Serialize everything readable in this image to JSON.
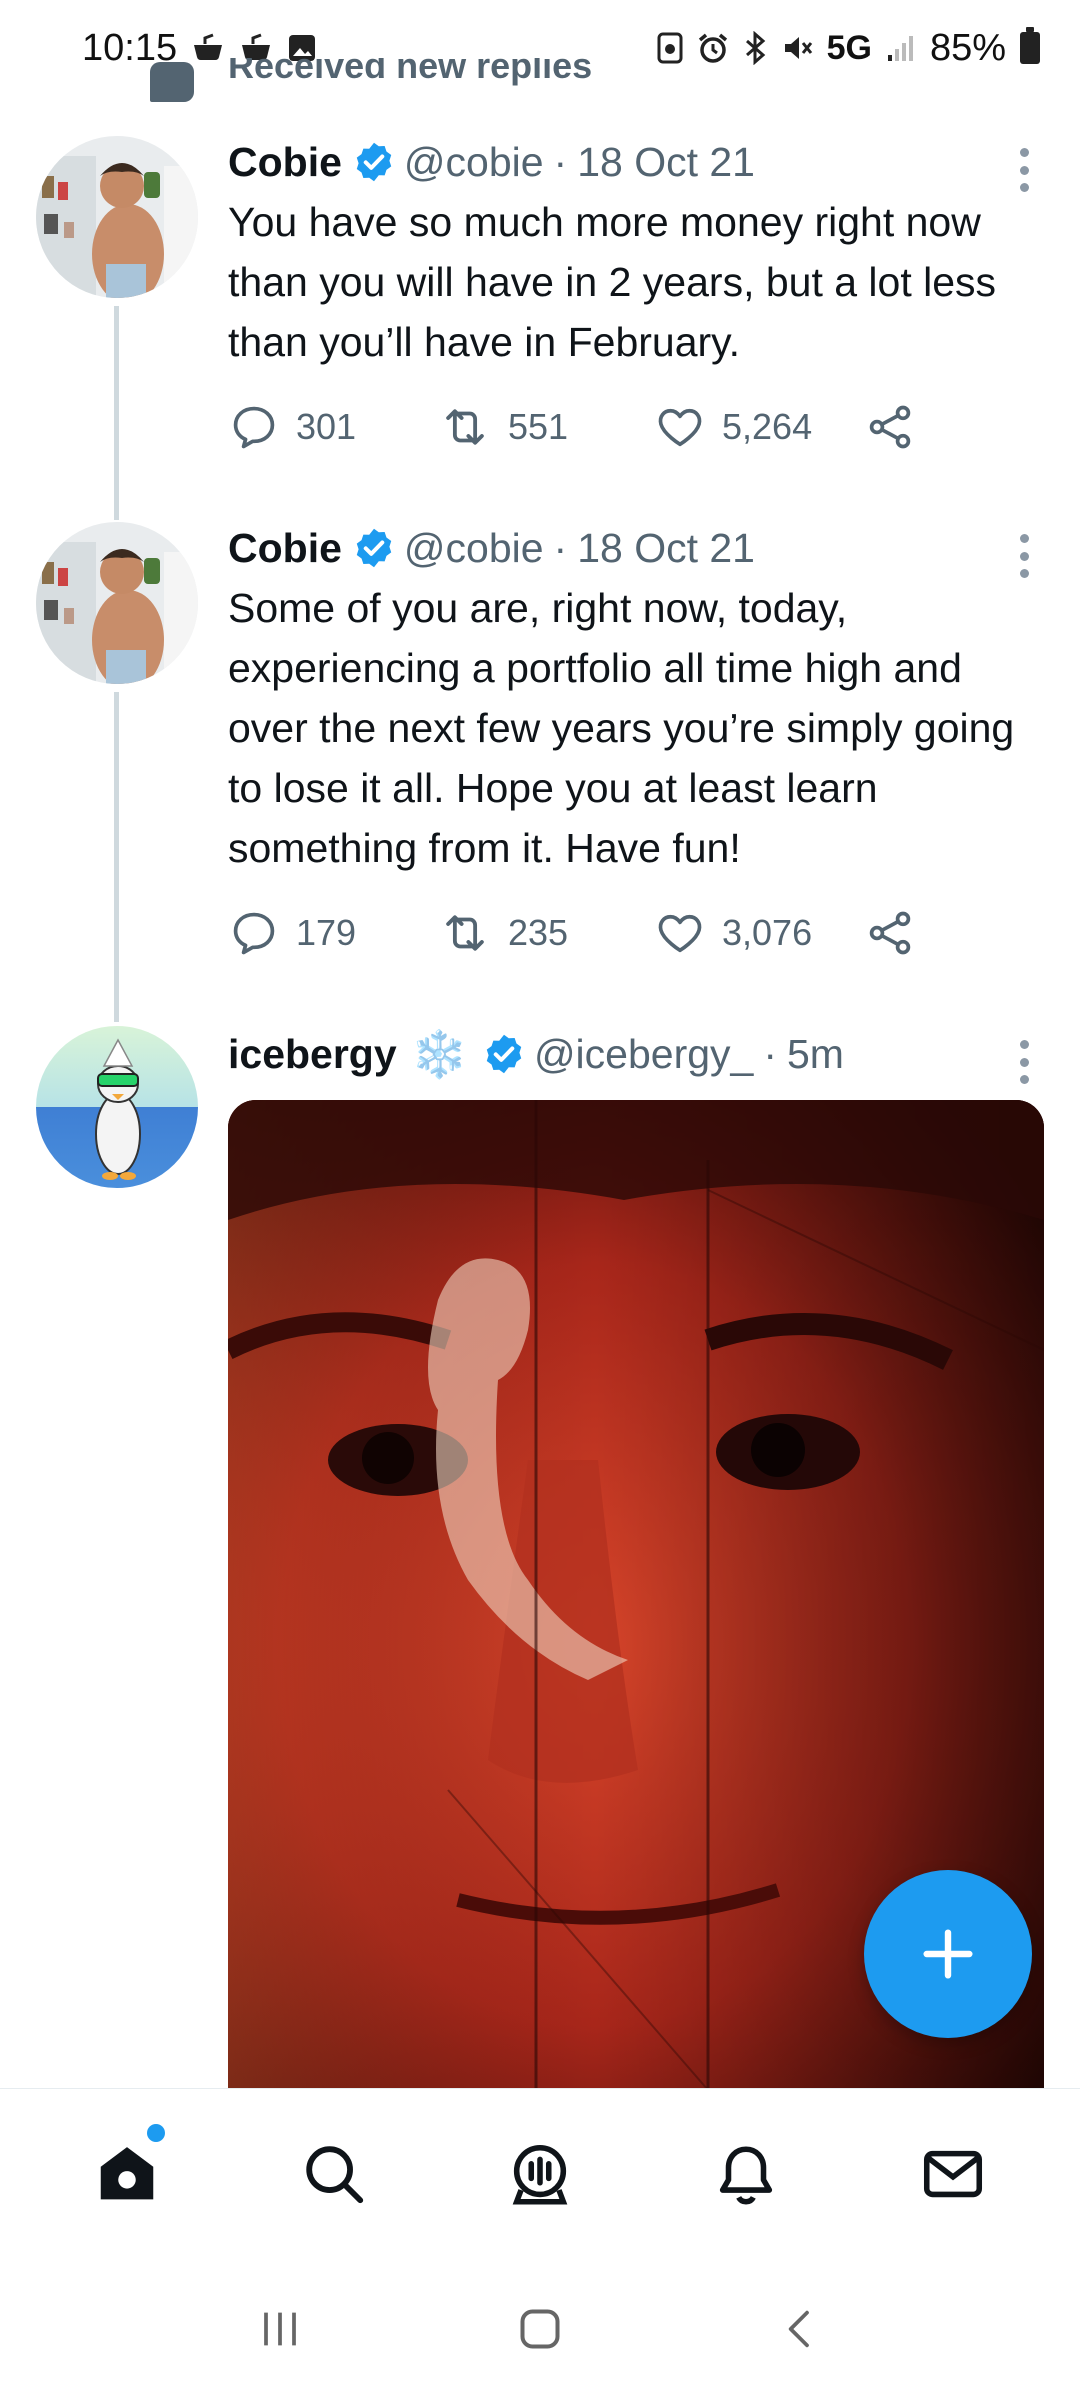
{
  "status_bar": {
    "time": "10:15",
    "network": "5G",
    "battery": "85%",
    "left_icons": [
      "app-notification-icon",
      "app-notification-icon",
      "gallery-icon"
    ],
    "right_icons": [
      "screenshot-icon",
      "alarm-icon",
      "bluetooth-icon",
      "mute-icon",
      "signal-icon",
      "battery-icon"
    ]
  },
  "peek_header": {
    "text": "Received new replies"
  },
  "tweets": [
    {
      "name": "Cobie",
      "handle": "@cobie",
      "separator": "·",
      "time": "18 Oct 21",
      "text": "You have so much more money right now than you will have in 2 years, but a lot less than you’ll have in February.",
      "replies": "301",
      "retweets": "551",
      "likes": "5,264"
    },
    {
      "name": "Cobie",
      "handle": "@cobie",
      "separator": "·",
      "time": "18 Oct 21",
      "text": "Some of you are, right now, today, experiencing a portfolio all time high and over the next few years you’re simply going to lose it all. Hope you at least learn something from it. Have fun!",
      "replies": "179",
      "retweets": "235",
      "likes": "3,076"
    },
    {
      "name": "icebergy",
      "name_emoji": "❄️",
      "handle": "@icebergy_",
      "separator": "·",
      "time": "5m"
    }
  ],
  "bottom_nav": [
    "home-icon",
    "search-icon",
    "spaces-icon",
    "notifications-icon",
    "messages-icon"
  ],
  "system_nav": [
    "recents-button",
    "home-button",
    "back-button"
  ],
  "colors": {
    "accent": "#1d9bf0",
    "muted": "#536471",
    "text": "#0f1419",
    "thread_line": "#cfd9de"
  }
}
